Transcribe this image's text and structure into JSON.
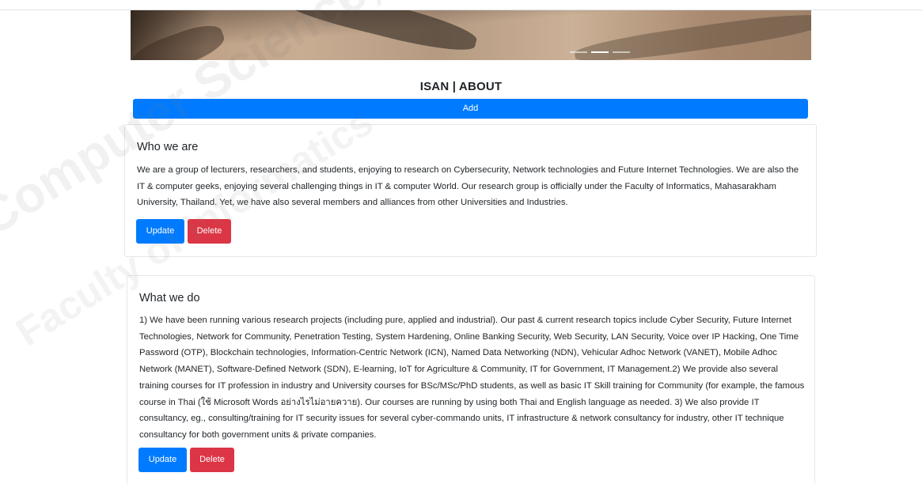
{
  "page": {
    "title": "ISAN | ABOUT",
    "add_label": "Add"
  },
  "hero": {
    "slides": 3,
    "active_slide": 2
  },
  "sections": [
    {
      "heading": "Who we are",
      "body": "We are a group of lecturers, researchers, and students, enjoying to research on Cybersecurity, Network technologies and Future Internet Technologies. We are also the IT & computer geeks, enjoying several challenging things in IT & computer World. Our research group is officially under the Faculty of Informatics, Mahasarakham University, Thailand. Yet, we have also several members and alliances from other Universities and Industries.",
      "update_label": "Update",
      "delete_label": "Delete"
    },
    {
      "heading": "What we do",
      "body": "1) We have been running various research projects (including pure, applied and industrial). Our past & current research topics include Cyber Security, Future Internet Technologies, Network for Community, Penetration Testing, System Hardening, Online Banking Security, Web Security, LAN Security, Voice over IP Hacking, One Time Password (OTP), Blockchain technologies, Information-Centric Network (ICN), Named Data Networking (NDN), Vehicular Adhoc Network (VANET), Mobile Adhoc Network (MANET), Software-Defined Network (SDN), E-learning, IoT for Agriculture & Community, IT for Government, IT Management.2) We provide also several training courses for IT profession in industry and University courses for BSc/MSc/PhD students, as well as basic IT Skill training for Community (for example, the famous course in Thai (ใช้ Microsoft Words อย่างไรไม่อายควาย). Our courses are running by using both Thai and English language as needed. 3) We also provide IT consultancy, eg., consulting/training for IT security issues for several cyber-commando units, IT infrastructure & network consultancy for industry, other IT technique consultancy for both government units & private companies.",
      "update_label": "Update",
      "delete_label": "Delete"
    }
  ],
  "watermark": {
    "line1": "Computer Science, Mahasarakham",
    "line2": "Faculty of Informatics"
  },
  "colors": {
    "primary": "#007bff",
    "danger": "#dc3545",
    "text": "#212529",
    "card_border": "#e5e7eb"
  }
}
